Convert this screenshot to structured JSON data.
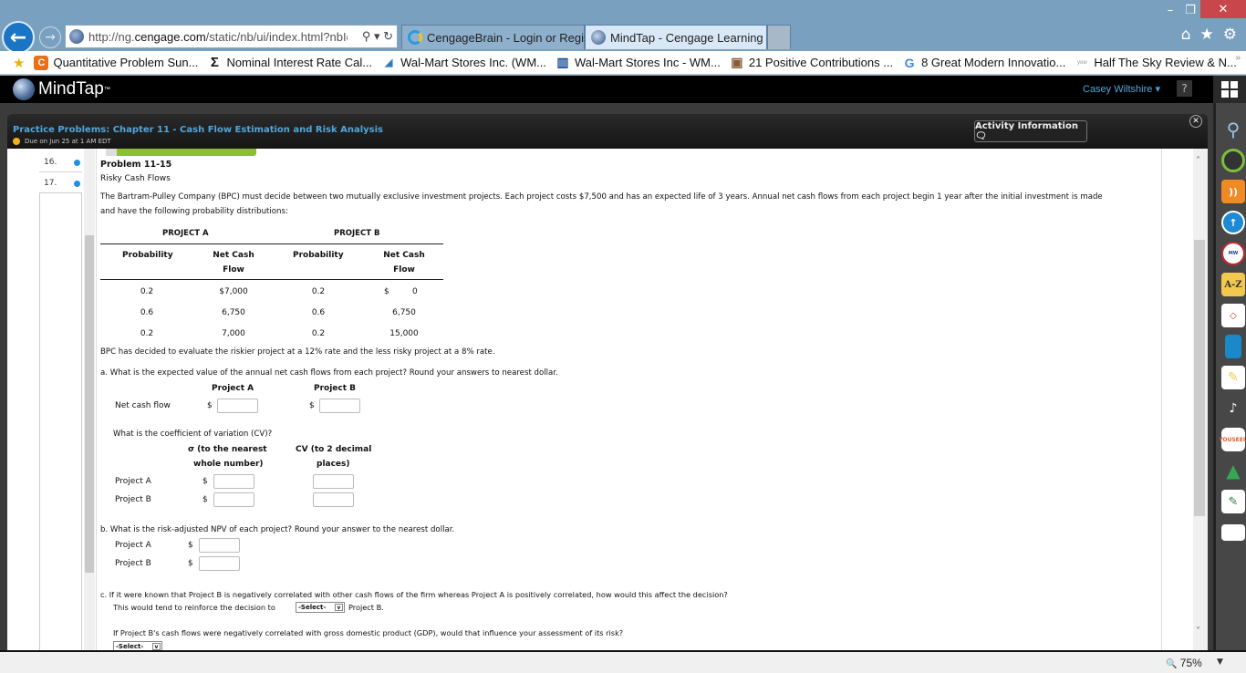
{
  "window": {
    "min_label": "–",
    "max_label": "❐",
    "close_label": "✕"
  },
  "nav": {
    "back_icon": "←",
    "forward_icon": "→",
    "url_prefix": "http://ng.",
    "url_domain": "cengage.com",
    "url_suffix": "/static/nb/ui/index.html?nbId=",
    "address_tools": "⚲ ▾ ↻",
    "tabs": [
      {
        "label": "CengageBrain - Login or Regis...",
        "active": false
      },
      {
        "label": "MindTap - Cengage Learning",
        "active": true,
        "close": "✕"
      }
    ],
    "right_icons": [
      "⌂",
      "★",
      "⚙"
    ]
  },
  "favorites": [
    {
      "label": "Quantitative Problem Sun...",
      "icon": "C"
    },
    {
      "label": "Nominal Interest Rate Cal...",
      "icon": "Σ"
    },
    {
      "label": "Wal-Mart Stores Inc. (WM...",
      "icon": "◢"
    },
    {
      "label": "Wal-Mart Stores Inc - WM...",
      "icon": "▥"
    },
    {
      "label": "21 Positive Contributions ...",
      "icon": "▣"
    },
    {
      "label": "8 Great Modern Innovatio...",
      "icon": "G"
    },
    {
      "label": "Half The Sky  Review & N...",
      "icon": "yow"
    }
  ],
  "favorites_more": "»",
  "mindtap": {
    "logo_text": "MindTap",
    "logo_tm": "™",
    "user_name": "Casey Wiltshire ▾",
    "help_label": "?"
  },
  "activity": {
    "title": "Practice Problems: Chapter 11 - Cash Flow Estimation and Risk Analysis",
    "due": "Due on Jun 25 at 1 AM EDT",
    "info_button": "Activity Information 🗨",
    "close_label": "✕"
  },
  "question_list": [
    {
      "num": "16."
    },
    {
      "num": "17."
    }
  ],
  "problem": {
    "title": "Problem 11-15",
    "subtitle": "Risky Cash Flows",
    "intro_line1": "The Bartram-Pulley Company (BPC) must decide between two mutually exclusive investment projects. Each project costs $7,500 and has an expected life of 3 years. Annual net cash flows from each project begin 1 year after the initial investment is made",
    "intro_line2": "and have the following probability distributions:",
    "table": {
      "group_a": "PROJECT A",
      "group_b": "PROJECT B",
      "col_prob": "Probability",
      "col_ncf_1": "Net Cash",
      "col_ncf_2": "Flow",
      "rows": [
        {
          "pa": "0.2",
          "ca": "$7,000",
          "pb": "0.2",
          "cb_sign": "$",
          "cb": "0"
        },
        {
          "pa": "0.6",
          "ca": "6,750",
          "pb": "0.6",
          "cb_sign": "",
          "cb": "6,750"
        },
        {
          "pa": "0.2",
          "ca": "7,000",
          "pb": "0.2",
          "cb_sign": "",
          "cb": "15,000"
        }
      ]
    },
    "rate_note": "BPC has decided to evaluate the riskier project at a 12% rate and the less risky project at a 8% rate.",
    "part_a": {
      "question": "a.  What is the expected value of the annual net cash flows from each project? Round your answers to nearest dollar.",
      "col_a": "Project A",
      "col_b": "Project B",
      "row_label": "Net cash flow",
      "currency": "$",
      "value_a": "",
      "value_b": "",
      "cv_question": "What is the coefficient of variation (CV)?",
      "sigma_header_1": "σ (to the nearest",
      "sigma_header_2": "whole number)",
      "cv_header_1": "CV (to 2 decimal",
      "cv_header_2": "places)",
      "rows": [
        {
          "label": "Project A",
          "sigma": "",
          "cv": ""
        },
        {
          "label": "Project B",
          "sigma": "",
          "cv": ""
        }
      ]
    },
    "part_b": {
      "question": "b.  What is the risk-adjusted NPV of each project? Round your answer to the nearest dollar.",
      "currency": "$",
      "rows": [
        {
          "label": "Project A",
          "value": ""
        },
        {
          "label": "Project B",
          "value": ""
        }
      ]
    },
    "part_c": {
      "question": "c.  If it were known that Project B is negatively correlated with other cash flows of the firm whereas Project A is positively correlated, how would this affect the decision?",
      "sentence_pre": "This would tend to reinforce the decision to",
      "sentence_post": "Project B.",
      "select_1": "-Select-",
      "gdp_question": "If Project B's cash flows were negatively correlated with gross domestic product (GDP), would that influence your assessment of its risk?",
      "select_2": "-Select-"
    }
  },
  "status_bar": {
    "zoom": "75%",
    "zoom_icon": "🔍",
    "dropdown": "▼"
  }
}
